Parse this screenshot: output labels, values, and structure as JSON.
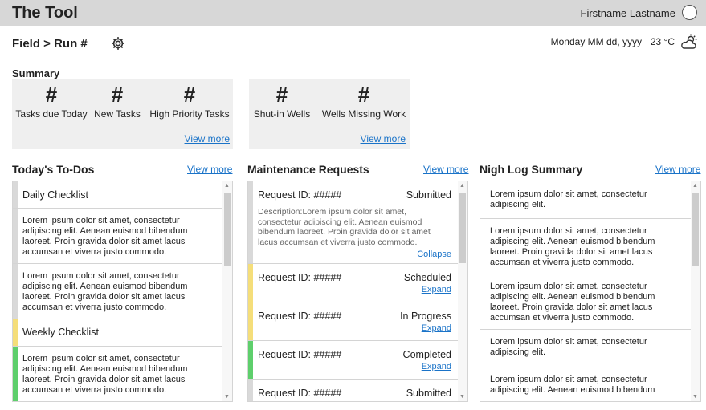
{
  "app": {
    "title": "The Tool",
    "user_name": "Firstname Lastname"
  },
  "header": {
    "breadcrumb": "Field > Run #",
    "date": "Monday MM dd, yyyy",
    "temperature": "23 °C",
    "weather_icon": "partly-cloudy-icon",
    "settings_icon": "gear-icon"
  },
  "summary": {
    "title": "Summary",
    "box1": {
      "stats": [
        {
          "value": "#",
          "label": "Tasks due Today"
        },
        {
          "value": "#",
          "label": "New Tasks"
        },
        {
          "value": "#",
          "label": "High Priority Tasks"
        }
      ],
      "link": "View more"
    },
    "box2": {
      "stats": [
        {
          "value": "#",
          "label": "Shut-in Wells"
        },
        {
          "value": "#",
          "label": "Wells Missing Work"
        }
      ],
      "link": "View more"
    }
  },
  "todos": {
    "title": "Today's To-Dos",
    "link": "View more",
    "items": [
      {
        "text": "Daily Checklist",
        "accent": "#d9d9d9"
      },
      {
        "text": "Lorem ipsum dolor sit amet, consectetur adipiscing elit. Aenean euismod bibendum laoreet. Proin gravida dolor sit amet lacus accumsan et viverra justo commodo.",
        "accent": "#d9d9d9"
      },
      {
        "text": "Lorem ipsum dolor sit amet, consectetur adipiscing elit. Aenean euismod bibendum laoreet. Proin gravida dolor sit amet lacus accumsan et viverra justo commodo.",
        "accent": "#d9d9d9"
      },
      {
        "text": "Weekly Checklist",
        "accent": "#f5de7a"
      },
      {
        "text": "Lorem ipsum dolor sit amet, consectetur adipiscing elit. Aenean euismod bibendum laoreet. Proin gravida dolor sit amet lacus accumsan et viverra justo commodo.",
        "accent": "#5ecf6c"
      }
    ]
  },
  "maintenance": {
    "title": "Maintenance Requests",
    "link": "View more",
    "items": [
      {
        "id": "Request ID: #####",
        "status": "Submitted",
        "description": "Description:Lorem ipsum dolor sit amet, consectetur adipiscing elit. Aenean euismod bibendum laoreet. Proin gravida dolor sit amet lacus accumsan et viverra justo commodo.",
        "action": "Collapse",
        "accent": "#d9d9d9"
      },
      {
        "id": "Request ID: #####",
        "status": "Scheduled",
        "action": "Expand",
        "accent": "#f5de7a"
      },
      {
        "id": "Request ID: #####",
        "status": "In Progress",
        "action": "Expand",
        "accent": "#f5de7a"
      },
      {
        "id": "Request ID: #####",
        "status": "Completed",
        "action": "Expand",
        "accent": "#5ecf6c"
      },
      {
        "id": "Request ID: #####",
        "status": "Submitted",
        "accent": "#d9d9d9"
      }
    ]
  },
  "nightlog": {
    "title": "Nigh Log Summary",
    "link": "View more",
    "items": [
      {
        "text": "Lorem ipsum dolor sit amet, consectetur adipiscing elit."
      },
      {
        "text": "Lorem ipsum dolor sit amet, consectetur adipiscing elit. Aenean euismod bibendum laoreet. Proin gravida dolor sit amet lacus accumsan et viverra justo commodo."
      },
      {
        "text": "Lorem ipsum dolor sit amet, consectetur adipiscing elit. Aenean euismod bibendum laoreet. Proin gravida dolor sit amet lacus accumsan et viverra justo commodo."
      },
      {
        "text": "Lorem ipsum dolor sit amet, consectetur adipiscing elit."
      },
      {
        "text": "Lorem ipsum dolor sit amet, consectetur adipiscing elit. Aenean euismod bibendum"
      }
    ]
  }
}
